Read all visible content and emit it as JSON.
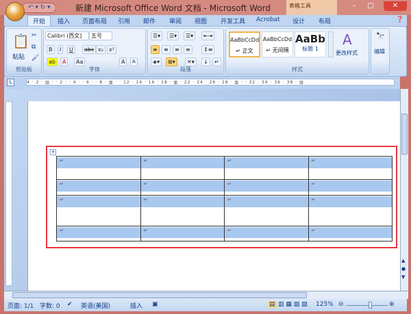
{
  "window": {
    "title": "新建 Microsoft Office Word 文档 - Microsoft Word",
    "context_tab": "表格工具",
    "minimize": "–",
    "maximize": "□",
    "close": "✕",
    "qat": "↶ ▾ ↻ ▾"
  },
  "tabs": [
    "开始",
    "插入",
    "页面布局",
    "引用",
    "邮件",
    "审阅",
    "视图",
    "开发工具",
    "Acrobat",
    "设计",
    "布局"
  ],
  "ribbon": {
    "clipboard": {
      "label": "剪贴板",
      "paste": "粘贴"
    },
    "font": {
      "label": "字体",
      "font_name": "Calibri (西文]",
      "font_size": "五号",
      "buttons": [
        "B",
        "I",
        "U",
        "abc",
        "x₂",
        "x²",
        "Aa",
        "A",
        "A",
        "A"
      ]
    },
    "paragraph": {
      "label": "段落"
    },
    "styles": {
      "label": "样式",
      "items": [
        {
          "preview": "AaBbCcDd",
          "name": "↵ 正文"
        },
        {
          "preview": "AaBbCcDd",
          "name": "↵ 无间隔"
        },
        {
          "preview": "AaBb",
          "name": "标题 1"
        }
      ],
      "change": "更改样式"
    },
    "editing": {
      "label": "编辑"
    }
  },
  "ruler": "4 · 2 · ▥ · · 2 · · 4 · · 6 · · 8 · ▥ · · 12 · 14 · 16 · 18 · ▥ · 22 · 24 · 26 · 28 · ▥ · · 32 · 34 · 36 · 38 · ▥",
  "table": {
    "rows": 4,
    "cols": 4,
    "cell_mark": "↵",
    "selected": true
  },
  "status": {
    "page": "页面: 1/1",
    "words": "字数: 0",
    "language": "英语(美国)",
    "mode": "插入",
    "zoom": "125%"
  }
}
